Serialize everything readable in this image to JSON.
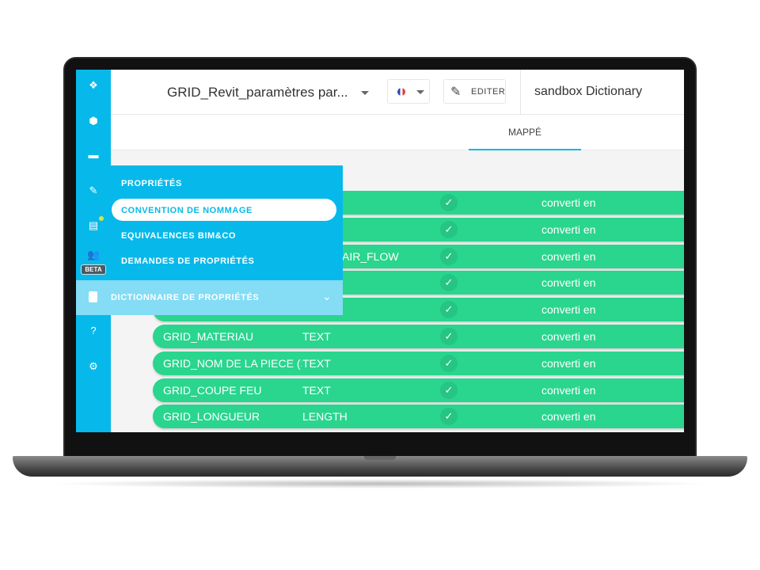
{
  "header": {
    "dataset_title": "GRID_Revit_paramètres par...",
    "language": "fr",
    "edit_label": "EDITER",
    "dictionary_title": "sandbox Dictionary"
  },
  "tabs": [
    {
      "label": "MAPPÉ",
      "active": true
    }
  ],
  "sidebar": {
    "icons": [
      "bim-objects-icon",
      "cube-icon",
      "folder-icon",
      "edit-icon",
      "chat-icon",
      "users-icon",
      "dictionary-icon",
      "help-icon",
      "settings-icon"
    ],
    "beta_badge": "BETA",
    "notification_color": "#d6e34a"
  },
  "menu": {
    "items": [
      {
        "label": "PROPRIÉTÉS"
      },
      {
        "label": "CONVENTION DE NOMMAGE",
        "selected": true
      },
      {
        "label": "EQUIVALENCES BIM&CO"
      },
      {
        "label": "DEMANDES DE PROPRIÉTÉS"
      }
    ],
    "section": "DICTIONNAIRE DE PROPRIÉTÉS"
  },
  "rows": [
    {
      "name": "",
      "type": "",
      "partial": "",
      "status": "✓",
      "action": "converti en"
    },
    {
      "name": "",
      "type": "",
      "partial": "",
      "status": "✓",
      "action": "converti en"
    },
    {
      "name": "",
      "type": "",
      "partial": "AIR_FLOW",
      "status": "✓",
      "action": "converti en"
    },
    {
      "name": "",
      "type": "",
      "partial": "",
      "status": "✓",
      "action": "converti en"
    },
    {
      "name": "",
      "type": "",
      "partial": "",
      "status": "✓",
      "action": "converti en"
    },
    {
      "name": "GRID_MATERIAU",
      "type": "TEXT",
      "partial": "",
      "status": "✓",
      "action": "converti en"
    },
    {
      "name": "GRID_NOM DE LA PIECE (S",
      "type": "TEXT",
      "partial": "",
      "status": "✓",
      "action": "converti en"
    },
    {
      "name": "GRID_COUPE FEU",
      "type": "TEXT",
      "partial": "",
      "status": "✓",
      "action": "converti en"
    },
    {
      "name": "GRID_LONGUEUR",
      "type": "LENGTH",
      "partial": "",
      "status": "✓",
      "action": "converti en"
    }
  ],
  "colors": {
    "primary": "#07b9ea",
    "mapped_row": "#2ad58e",
    "menu_section": "#84dcf5"
  }
}
